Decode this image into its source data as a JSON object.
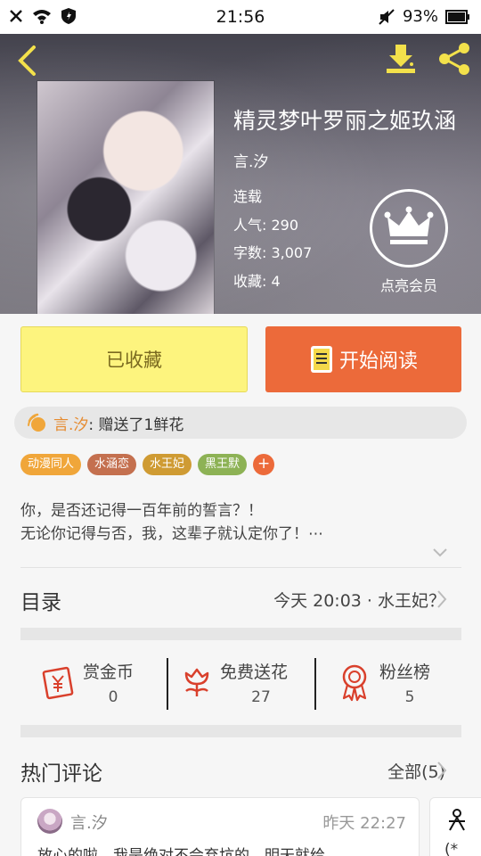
{
  "status_bar": {
    "time": "21:56",
    "battery": "93%"
  },
  "book": {
    "title": "精灵梦叶罗丽之姬玖涵",
    "author": "言.汐",
    "status": "连载",
    "popularity": "人气: 290",
    "word_count": "字数: 3,007",
    "favorites": "收藏: 4"
  },
  "member_label": "点亮会员",
  "actions": {
    "collected_label": "已收藏",
    "read_label": "开始阅读"
  },
  "gift": {
    "name": "言.汐",
    "text": ": 赠送了1鲜花"
  },
  "tags": [
    {
      "label": "动漫同人",
      "color": "#f0a63a"
    },
    {
      "label": "水涵恋",
      "color": "#c4704f"
    },
    {
      "label": "水王妃",
      "color": "#cf9b33"
    },
    {
      "label": "黑王默",
      "color": "#8db255"
    }
  ],
  "tag_add": "+",
  "description": {
    "line1": "你，是否还记得一百年前的誓言？！",
    "line2": "无论你记得与否，我，这辈子就认定你了！⋯"
  },
  "catalog": {
    "title": "目录",
    "latest": "今天 20:03 · 水王妃？"
  },
  "stats": [
    {
      "label": "赏金币",
      "value": "0"
    },
    {
      "label": "免费送花",
      "value": "27"
    },
    {
      "label": "粉丝榜",
      "value": "5"
    }
  ],
  "comments": {
    "title": "热门评论",
    "all_label": "全部(5)",
    "items": [
      {
        "author": "言.汐",
        "time": "昨天 22:27",
        "text": "放心的啦，我是绝对不会弃坑的，明天就给"
      }
    ],
    "second_snippet": "(*"
  },
  "colors": {
    "accent_orange": "#ec6a3a",
    "collected_yellow": "#fdf47e",
    "icon_red": "#d9402c"
  }
}
